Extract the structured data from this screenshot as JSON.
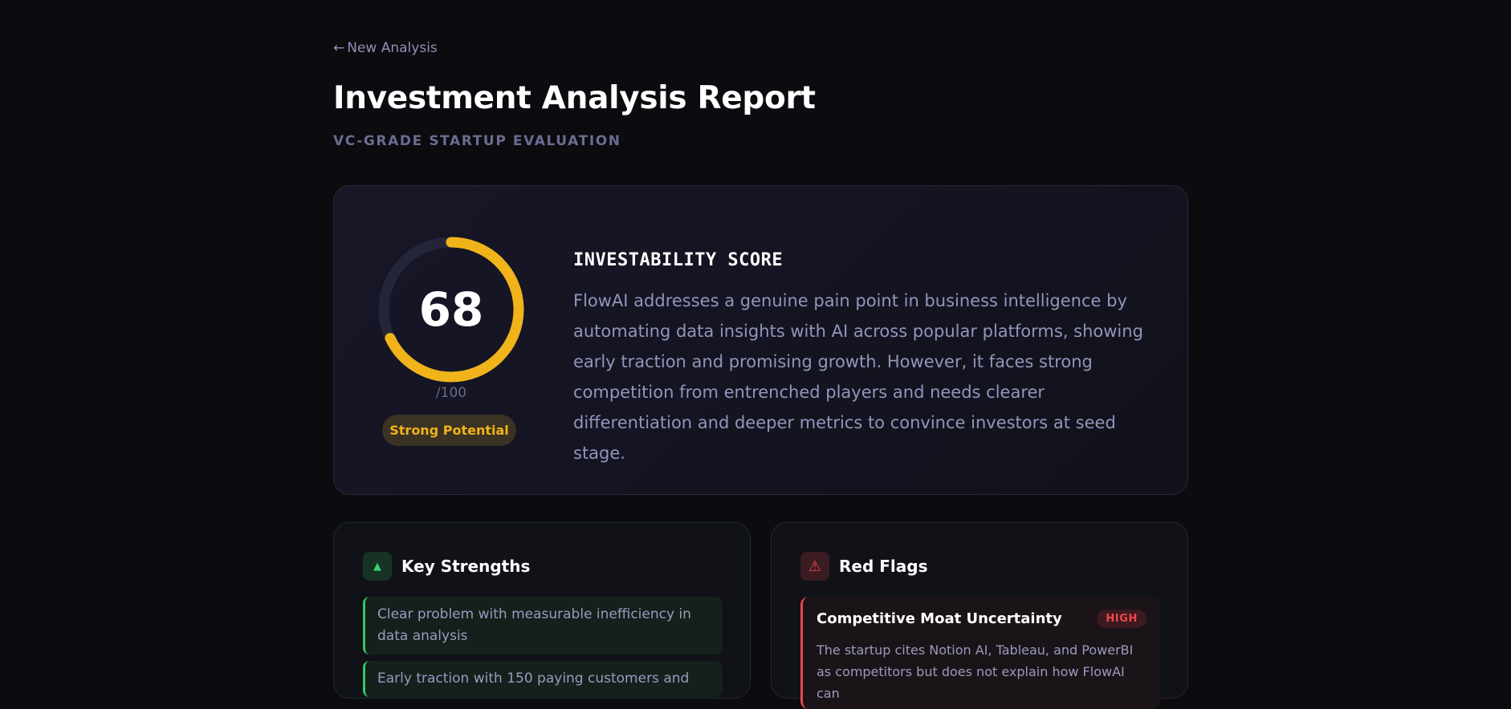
{
  "nav": {
    "back_arrow": "←",
    "back_label": "New Analysis"
  },
  "header": {
    "title": "Investment Analysis Report",
    "subtitle": "VC-GRADE STARTUP EVALUATION"
  },
  "score": {
    "value": "68",
    "max_label": "/100",
    "fraction": 0.68,
    "rating_label": "Strong Potential",
    "section_title": "INVESTABILITY SCORE",
    "summary": "FlowAI addresses a genuine pain point in business intelligence by automating data insights with AI across popular platforms, showing early traction and promising growth. However, it faces strong competition from entrenched players and needs clearer differentiation and deeper metrics to convince investors at seed stage.",
    "accent_color": "#f0b31a",
    "track_color": "#25253a"
  },
  "strengths": {
    "icon": "triangle-up-icon",
    "title": "Key Strengths",
    "items": [
      "Clear problem with measurable inefficiency in data analysis",
      "Early traction with 150 paying customers and"
    ]
  },
  "red_flags": {
    "icon": "warning-icon",
    "title": "Red Flags",
    "items": [
      {
        "title": "Competitive Moat Uncertainty",
        "severity": "HIGH",
        "description": "The startup cites Notion AI, Tableau, and PowerBI as competitors but does not explain how FlowAI can"
      }
    ]
  }
}
